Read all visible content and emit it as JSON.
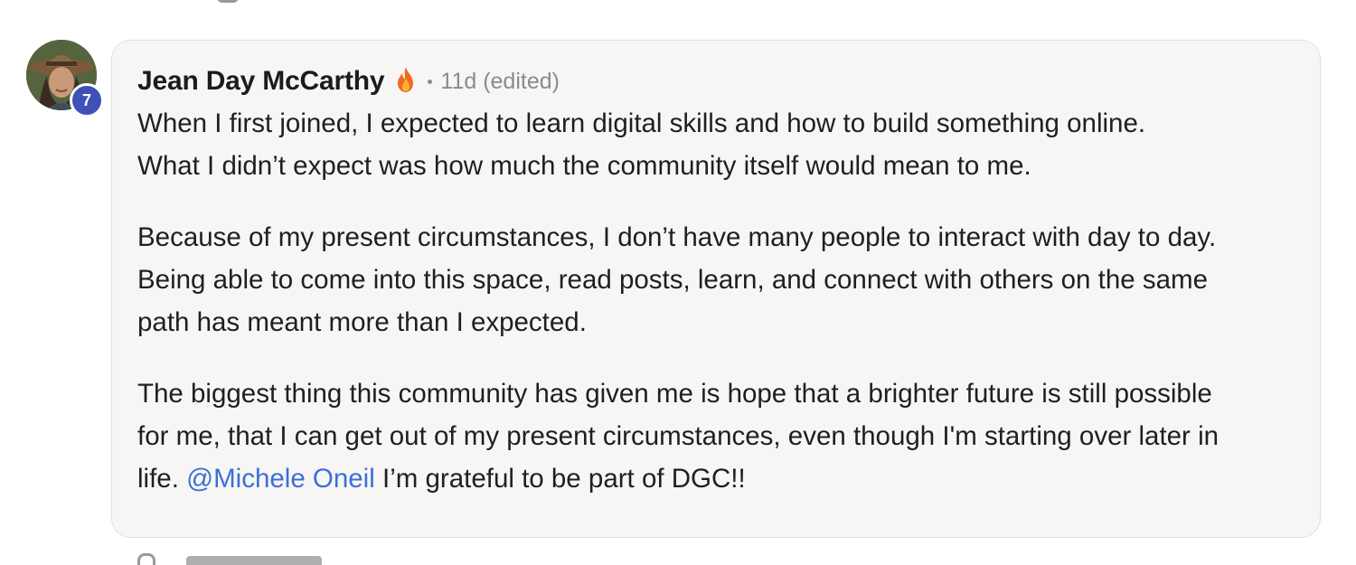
{
  "comment": {
    "author": "Jean Day McCarthy",
    "author_flair_icon": "fire-icon",
    "timestamp": "11d (edited)",
    "level": "7",
    "paragraphs": [
      "When I first joined, I expected to learn digital skills and how to build something online.\nWhat I didn’t expect was how much the community itself would mean to me.",
      "Because of my present circumstances, I don’t have many people to interact with day to day.\nBeing able to come into this space, read posts, learn, and connect with others on the same\npath has meant more than I expected.",
      "The biggest thing this community has given me is hope that a brighter future is still possible\nfor me, that I can get out of my present circumstances, even though I'm starting over later in\nlife."
    ],
    "mention": "@Michele Oneil",
    "closing_text": " I’m grateful to be part of DGC!!"
  },
  "colors": {
    "level_badge": "#3f51b5",
    "mention": "#3b6fd6",
    "card_background": "#f7f6f5"
  }
}
